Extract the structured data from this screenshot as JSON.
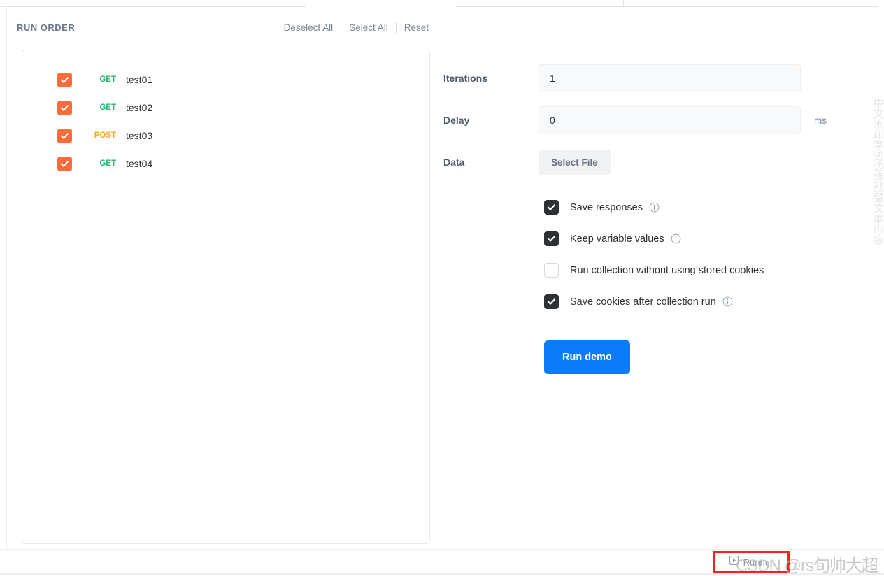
{
  "panel": {
    "title": "RUN ORDER",
    "actions": [
      {
        "label": "Deselect All"
      },
      {
        "label": "Select All"
      },
      {
        "label": "Reset"
      }
    ]
  },
  "requests": [
    {
      "method": "GET",
      "name": "test01",
      "checked": true
    },
    {
      "method": "GET",
      "name": "test02",
      "checked": true
    },
    {
      "method": "POST",
      "name": "test03",
      "checked": true
    },
    {
      "method": "GET",
      "name": "test04",
      "checked": true
    }
  ],
  "settings": {
    "iterations": {
      "label": "Iterations",
      "value": "1",
      "placeholder": "1"
    },
    "delay": {
      "label": "Delay",
      "value": "0",
      "placeholder": "0",
      "unit": "ms"
    },
    "data": {
      "label": "Data",
      "button_label": "Select File"
    }
  },
  "options": [
    {
      "label": "Save responses",
      "checked": true,
      "has_info": true
    },
    {
      "label": "Keep variable values",
      "checked": true,
      "has_info": true
    },
    {
      "label": "Run collection without using stored cookies",
      "checked": false,
      "has_info": false
    },
    {
      "label": "Save cookies after collection run",
      "checked": true,
      "has_info": true
    }
  ],
  "run_button": {
    "label": "Run demo"
  },
  "status_bar": {
    "runner_label": "Runner",
    "runner_icon": "play-square-icon"
  },
  "watermark": {
    "text": "CSDN @rs旬帅大超"
  },
  "colors": {
    "accent_orange": "#ff6c37",
    "method_get": "#2bb673",
    "method_post": "#ffa724",
    "run_button_blue": "#0d7bf7",
    "checkbox_dark": "#2e3134",
    "highlight_red": "#fc1e1e"
  }
}
